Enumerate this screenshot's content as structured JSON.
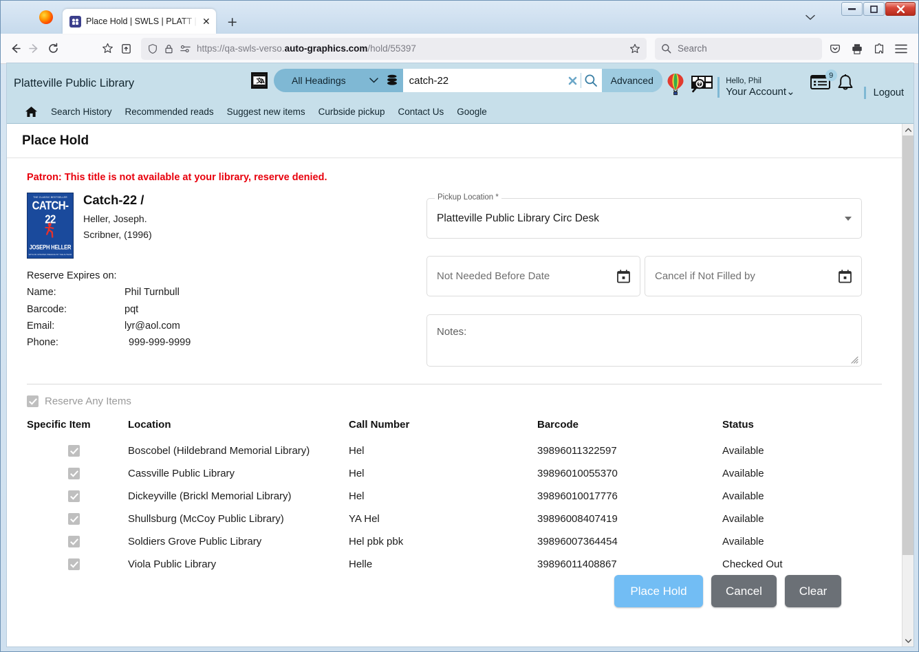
{
  "browser": {
    "tab": {
      "title": "Place Hold | SWLS | PLATT | Aut",
      "favicon": "book-icon",
      "close_label": "✕"
    },
    "new_tab_label": "+",
    "tab_list_chevron": "⌄",
    "window_controls": {
      "minimize": "–",
      "maximize": "□",
      "close": "✕"
    },
    "url": {
      "prefix": "https://qa-swls-verso.",
      "domain": "auto-graphics.com",
      "path": "/hold/55397"
    },
    "search": {
      "placeholder": "Search"
    }
  },
  "app_header": {
    "library_name": "Platteville Public Library",
    "headings_dropdown": "All Headings",
    "query_value": "catch-22",
    "advanced_label": "Advanced",
    "hello_text": "Hello, Phil",
    "your_account_label": "Your Account",
    "logout_label": "Logout",
    "notifications_badge": "9"
  },
  "nav_links": [
    "Search History",
    "Recommended reads",
    "Suggest new items",
    "Curbside pickup",
    "Contact Us",
    "Google"
  ],
  "main": {
    "page_title": "Place Hold",
    "alert_message": "Patron: This title is not available at your library, reserve denied.",
    "bib": {
      "title": "Catch-22 /",
      "author": "Heller, Joseph.",
      "publisher": "Scribner, (1996)",
      "cover": {
        "top_line": "THE CLASSIC BESTSELLER",
        "title": "CATCH-22",
        "author": "JOSEPH HELLER",
        "bottom_line": "WITH AN UPDATED PREFACE BY THE AUTHOR"
      }
    },
    "patron": {
      "reserve_expires_label": "Reserve Expires on:",
      "rows": [
        {
          "label": "Name:",
          "value": "Phil Turnbull"
        },
        {
          "label": "Barcode:",
          "value": "pqt"
        },
        {
          "label": "Email:",
          "value": "lyr@aol.com"
        },
        {
          "label": "Phone:",
          "value": "999-999-9999"
        }
      ]
    },
    "form": {
      "pickup_legend": "Pickup Location *",
      "pickup_value": "Platteville Public Library Circ Desk",
      "not_needed_before_placeholder": "Not Needed Before Date",
      "cancel_if_not_filled_placeholder": "Cancel if Not Filled by",
      "notes_placeholder": "Notes:"
    },
    "reserve_any_label": "Reserve Any Items",
    "table": {
      "headers": [
        "Specific Item",
        "Location",
        "Call Number",
        "Barcode",
        "Status"
      ],
      "rows": [
        {
          "location": "Boscobel (Hildebrand Memorial Library)",
          "call_number": "Hel",
          "barcode": "39896011322597",
          "status": "Available"
        },
        {
          "location": "Cassville Public Library",
          "call_number": "Hel",
          "barcode": "39896010055370",
          "status": "Available"
        },
        {
          "location": "Dickeyville (Brickl Memorial Library)",
          "call_number": "Hel",
          "barcode": "39896010017776",
          "status": "Available"
        },
        {
          "location": "Shullsburg (McCoy Public Library)",
          "call_number": "YA Hel",
          "barcode": "39896008407419",
          "status": "Available"
        },
        {
          "location": "Soldiers Grove Public Library",
          "call_number": "Hel pbk pbk",
          "barcode": "39896007364454",
          "status": "Available"
        },
        {
          "location": "Viola Public Library",
          "call_number": "Helle",
          "barcode": "39896011408867",
          "status": "Checked Out"
        }
      ]
    },
    "buttons": {
      "place_hold": "Place Hold",
      "cancel": "Cancel",
      "clear": "Clear"
    }
  },
  "colors": {
    "header_bg": "#c7dfea",
    "search_bg": "#7fb8d4",
    "advanced_bg": "#9ecbe0",
    "alert_red": "#e8000d",
    "place_hold_blue": "#72bdf4",
    "gray_button": "#6b7076"
  }
}
